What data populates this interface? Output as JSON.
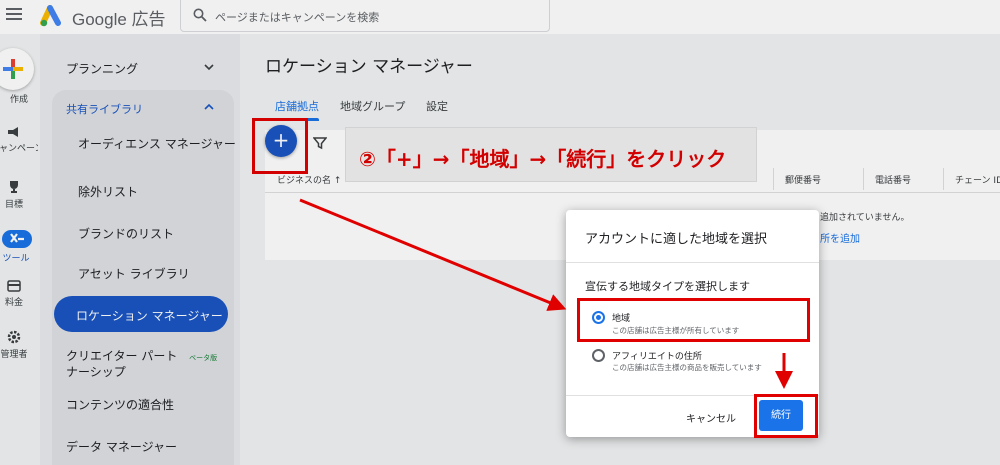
{
  "app": {
    "brand": "Google 広告"
  },
  "search": {
    "placeholder": "ページまたはキャンペーンを検索"
  },
  "rail": {
    "create": "作成",
    "campaigns": "キャンペーン",
    "goals": "目標",
    "tools": "ツール",
    "billing": "料金",
    "admin": "管理者"
  },
  "sidebar": {
    "planning": "プランニング",
    "shared_library": "共有ライブラリ",
    "items": [
      "オーディエンス マネージャー",
      "除外リスト",
      "ブランドのリスト",
      "アセット ライブラリ",
      "ロケーション マネージャー"
    ],
    "creator_partnership_1": "クリエイター パート",
    "creator_partnership_2": "ナーシップ",
    "beta": "ベータ版",
    "content_suitability": "コンテンツの適合性",
    "data_manager": "データ マネージャー"
  },
  "main": {
    "title": "ロケーション マネージャー",
    "tabs": [
      "店舗拠点",
      "地域グループ",
      "設定"
    ],
    "columns": [
      "ビジネスの名",
      "郵便番号",
      "電話番号",
      "チェーン ID"
    ],
    "empty_text": "追加されていません。",
    "add_link": "所を追加"
  },
  "callout": {
    "text": "②「+」→「地域」→「続行」をクリック"
  },
  "dialog": {
    "title": "アカウントに適した地域を選択",
    "subtitle": "宣伝する地域タイプを選択します",
    "options": [
      {
        "label": "地域",
        "desc": "この店舗は広告主様が所有しています",
        "checked": true
      },
      {
        "label": "アフィリエイトの住所",
        "desc": "この店舗は広告主様の商品を販売しています",
        "checked": false
      }
    ],
    "cancel": "キャンセル",
    "continue": "続行"
  },
  "colors": {
    "accent": "#1a73e8",
    "highlight": "#e00000",
    "nav_active": "#1a56c4"
  }
}
